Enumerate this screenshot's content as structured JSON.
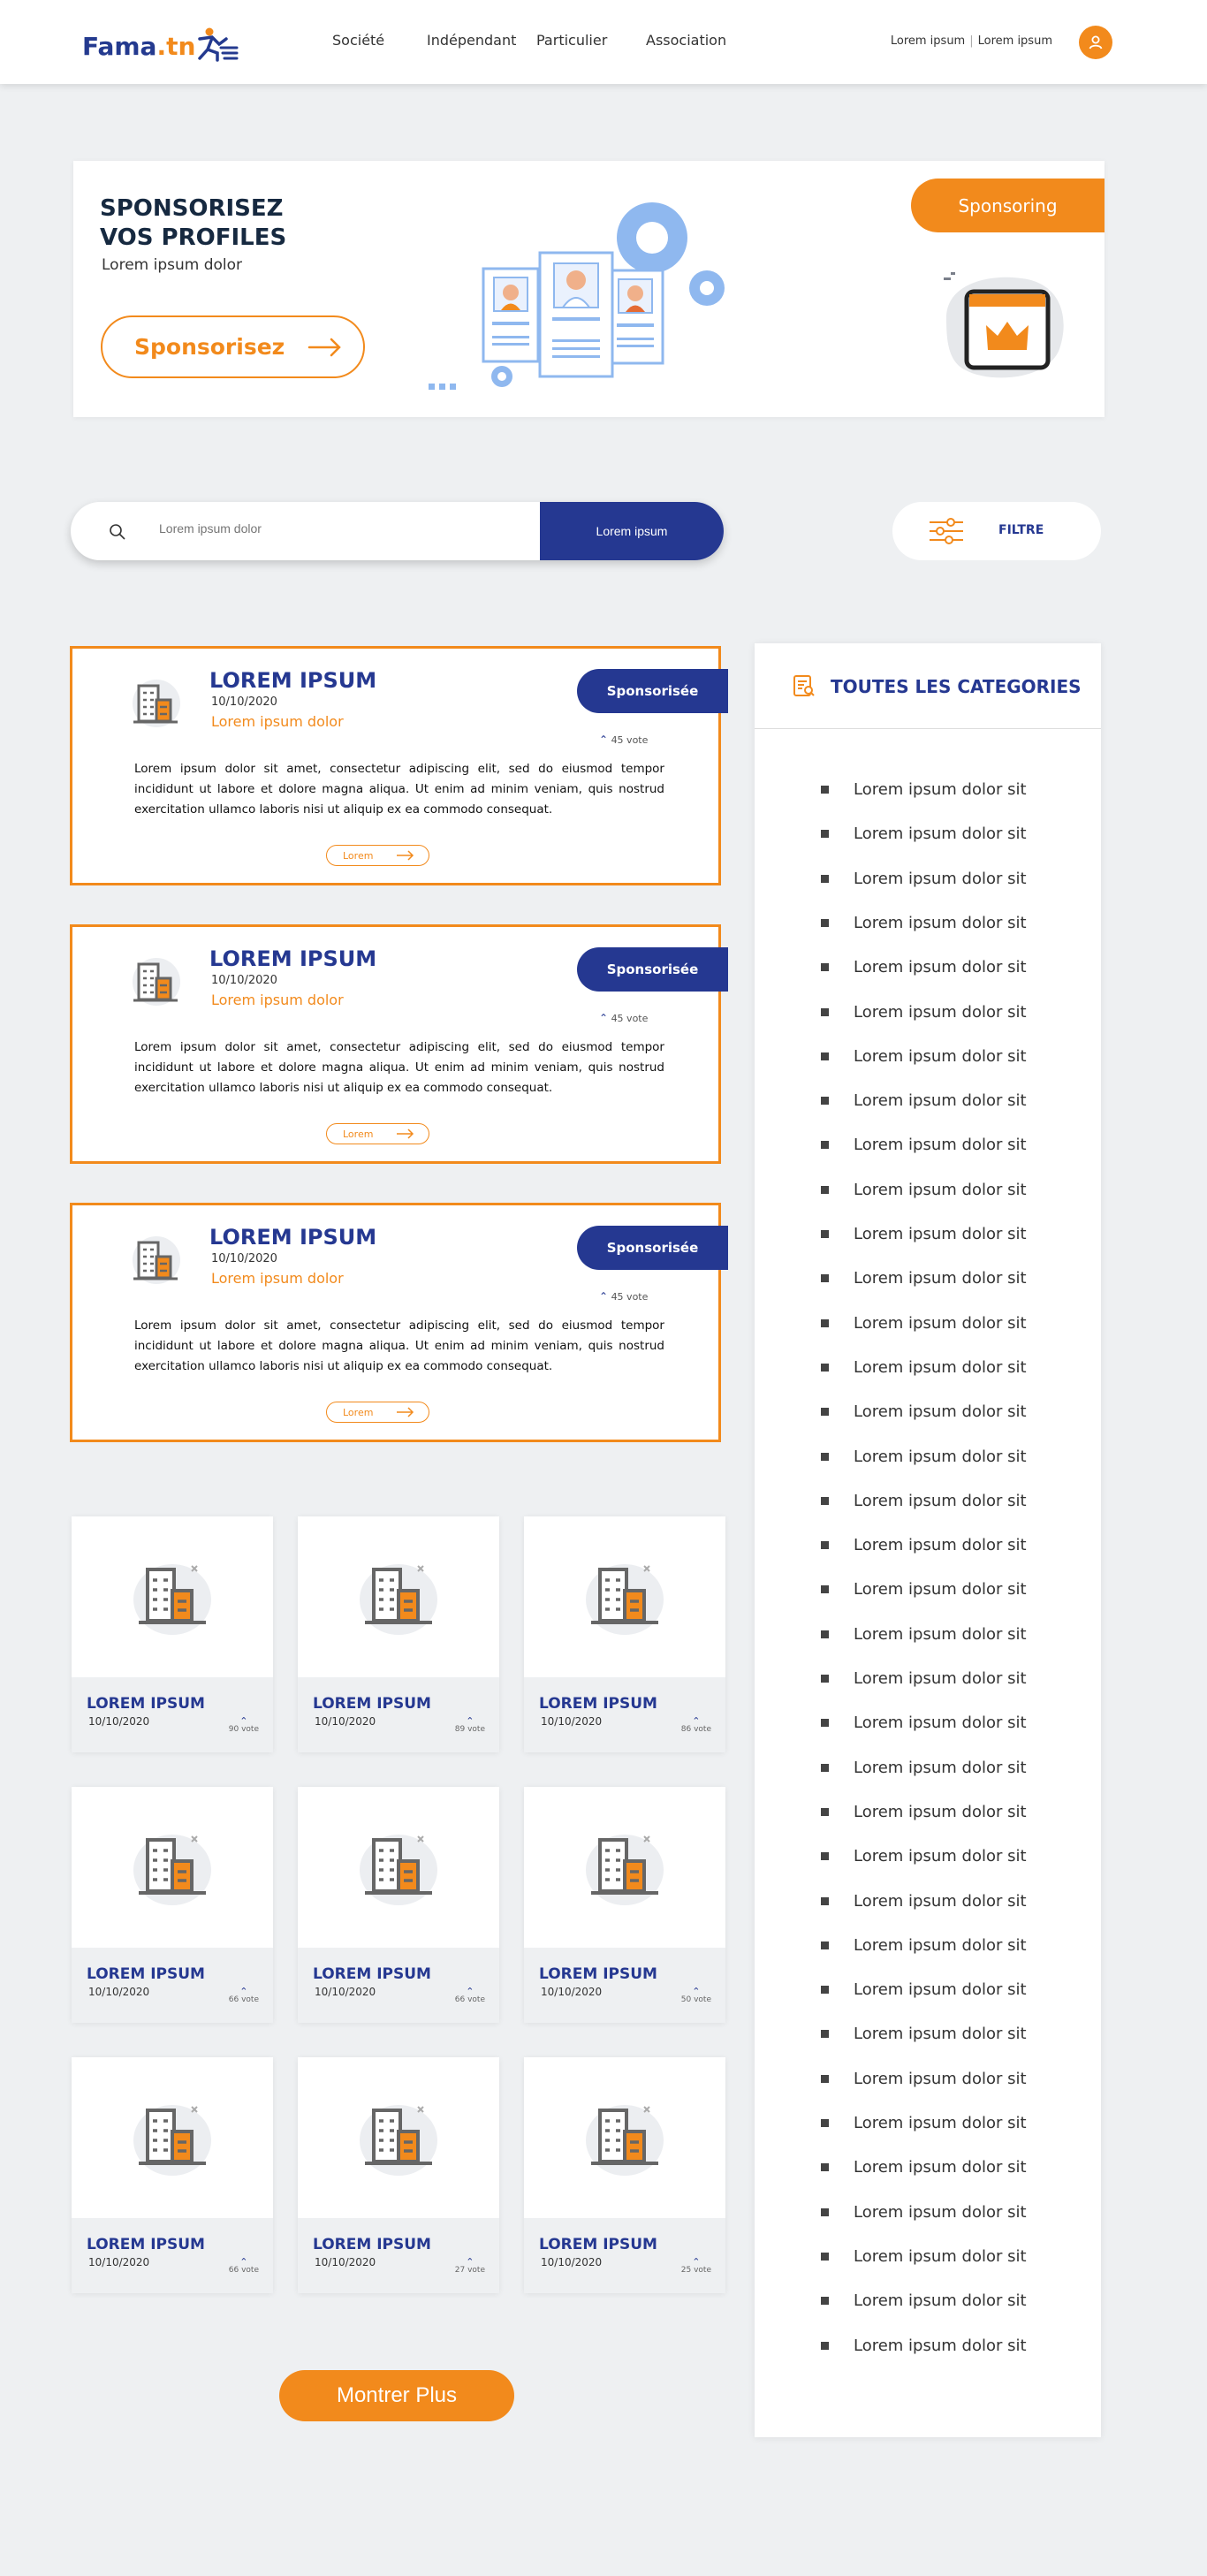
{
  "header": {
    "logo": {
      "main": "Fama",
      "suffix": ".tn"
    },
    "nav": [
      "Société",
      "Indépendant",
      "Particulier",
      "Association"
    ],
    "links": [
      "Lorem ipsum",
      "Lorem ipsum"
    ]
  },
  "banner": {
    "title_line1": "SPONSORISEZ",
    "title_line2": "VOS PROFILES",
    "subtitle": "Lorem ipsum dolor",
    "button_label": "Sponsorisez",
    "tag": "Sponsoring"
  },
  "search": {
    "placeholder": "Lorem ipsum dolor",
    "button_label": "Lorem ipsum",
    "filter_label": "FILTRE"
  },
  "sponsored": [
    {
      "title": "LOREM IPSUM",
      "date": "10/10/2020",
      "subtitle": "Lorem ipsum dolor",
      "badge": "Sponsorisée",
      "vote": "45 vote",
      "description": "Lorem ipsum dolor sit amet, consectetur adipiscing elit, sed do eiusmod tempor incididunt ut labore et dolore magna aliqua. Ut enim ad minim veniam, quis nostrud exercitation ullamco laboris nisi ut aliquip ex ea commodo consequat.",
      "more": "Lorem"
    },
    {
      "title": "LOREM IPSUM",
      "date": "10/10/2020",
      "subtitle": "Lorem ipsum dolor",
      "badge": "Sponsorisée",
      "vote": "45 vote",
      "description": "Lorem ipsum dolor sit amet, consectetur adipiscing elit, sed do eiusmod tempor incididunt ut labore et dolore magna aliqua. Ut enim ad minim veniam, quis nostrud exercitation ullamco laboris nisi ut aliquip ex ea commodo consequat.",
      "more": "Lorem"
    },
    {
      "title": "LOREM IPSUM",
      "date": "10/10/2020",
      "subtitle": "Lorem ipsum dolor",
      "badge": "Sponsorisée",
      "vote": "45 vote",
      "description": "Lorem ipsum dolor sit amet, consectetur adipiscing elit, sed do eiusmod tempor incididunt ut labore et dolore magna aliqua. Ut enim ad minim veniam, quis nostrud exercitation ullamco laboris nisi ut aliquip ex ea commodo consequat.",
      "more": "Lorem"
    }
  ],
  "grid": [
    {
      "title": "LOREM IPSUM",
      "date": "10/10/2020",
      "vote": "90 vote"
    },
    {
      "title": "LOREM IPSUM",
      "date": "10/10/2020",
      "vote": "89 vote"
    },
    {
      "title": "LOREM IPSUM",
      "date": "10/10/2020",
      "vote": "86 vote"
    },
    {
      "title": "LOREM IPSUM",
      "date": "10/10/2020",
      "vote": "66 vote"
    },
    {
      "title": "LOREM IPSUM",
      "date": "10/10/2020",
      "vote": "66 vote"
    },
    {
      "title": "LOREM IPSUM",
      "date": "10/10/2020",
      "vote": "50 vote"
    },
    {
      "title": "LOREM IPSUM",
      "date": "10/10/2020",
      "vote": "66 vote"
    },
    {
      "title": "LOREM IPSUM",
      "date": "10/10/2020",
      "vote": "27 vote"
    },
    {
      "title": "LOREM IPSUM",
      "date": "10/10/2020",
      "vote": "25 vote"
    }
  ],
  "show_more": "Montrer Plus",
  "sidebar": {
    "title": "TOUTES LES CATEGORIES",
    "items": [
      "Lorem ipsum dolor sit",
      "Lorem ipsum dolor sit",
      "Lorem ipsum dolor sit",
      "Lorem ipsum dolor sit",
      "Lorem ipsum dolor sit",
      "Lorem ipsum dolor sit",
      "Lorem ipsum dolor sit",
      "Lorem ipsum dolor sit",
      "Lorem ipsum dolor sit",
      "Lorem ipsum dolor sit",
      "Lorem ipsum dolor sit",
      "Lorem ipsum dolor sit",
      "Lorem ipsum dolor sit",
      "Lorem ipsum dolor sit",
      "Lorem ipsum dolor sit",
      "Lorem ipsum dolor sit",
      "Lorem ipsum dolor sit",
      "Lorem ipsum dolor sit",
      "Lorem ipsum dolor sit",
      "Lorem ipsum dolor sit",
      "Lorem ipsum dolor sit",
      "Lorem ipsum dolor sit",
      "Lorem ipsum dolor sit",
      "Lorem ipsum dolor sit",
      "Lorem ipsum dolor sit",
      "Lorem ipsum dolor sit",
      "Lorem ipsum dolor sit",
      "Lorem ipsum dolor sit",
      "Lorem ipsum dolor sit",
      "Lorem ipsum dolor sit",
      "Lorem ipsum dolor sit",
      "Lorem ipsum dolor sit",
      "Lorem ipsum dolor sit",
      "Lorem ipsum dolor sit",
      "Lorem ipsum dolor sit",
      "Lorem ipsum dolor sit"
    ]
  },
  "colors": {
    "brand_blue": "#253891",
    "brand_orange": "#f28a1c",
    "background": "#eef0f2"
  }
}
